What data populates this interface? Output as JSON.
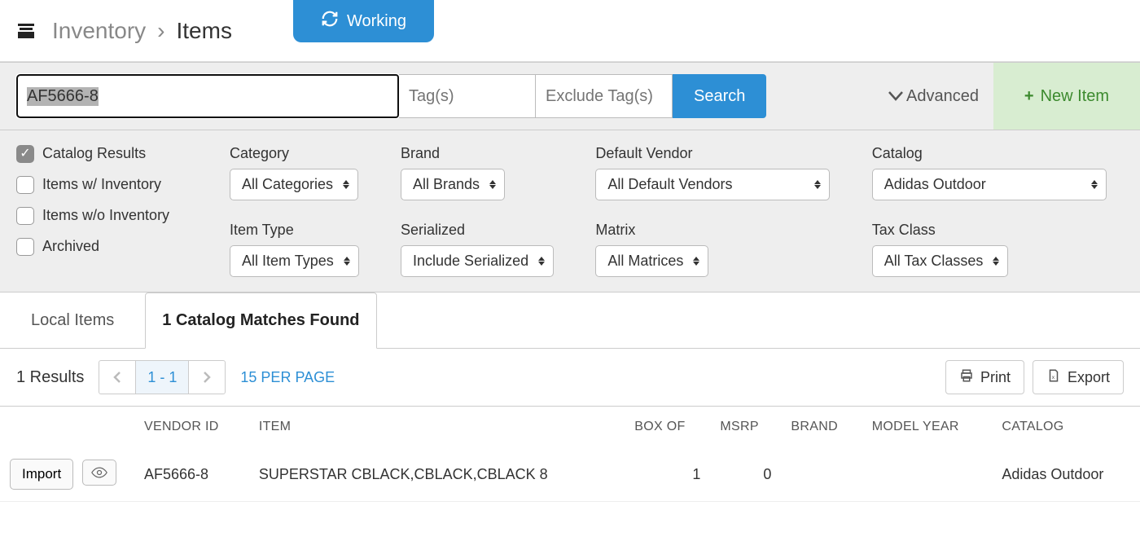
{
  "breadcrumb": {
    "root": "Inventory",
    "current": "Items"
  },
  "status_chip": "Working",
  "search": {
    "value": "AF5666-8",
    "tags_placeholder": "Tag(s)",
    "exclude_tags_placeholder": "Exclude Tag(s)",
    "search_button": "Search",
    "advanced_label": "Advanced",
    "new_item_label": "New Item"
  },
  "filter_checkboxes": {
    "catalog_results": {
      "label": "Catalog Results",
      "checked": true
    },
    "items_with_inventory": {
      "label": "Items w/ Inventory",
      "checked": false
    },
    "items_without_inventory": {
      "label": "Items w/o Inventory",
      "checked": false
    },
    "archived": {
      "label": "Archived",
      "checked": false
    }
  },
  "filters": {
    "category": {
      "label": "Category",
      "value": "All Categories"
    },
    "brand": {
      "label": "Brand",
      "value": "All Brands"
    },
    "vendor": {
      "label": "Default Vendor",
      "value": "All Default Vendors"
    },
    "catalog": {
      "label": "Catalog",
      "value": "Adidas Outdoor"
    },
    "item_type": {
      "label": "Item Type",
      "value": "All Item Types"
    },
    "serialized": {
      "label": "Serialized",
      "value": "Include Serialized"
    },
    "matrix": {
      "label": "Matrix",
      "value": "All Matrices"
    },
    "tax_class": {
      "label": "Tax Class",
      "value": "All Tax Classes"
    }
  },
  "tabs": {
    "local": "Local Items",
    "catalog_matches": "1 Catalog Matches Found"
  },
  "listbar": {
    "results": "1 Results",
    "page_range": "1 - 1",
    "per_page": "15 PER PAGE",
    "print": "Print",
    "export": "Export"
  },
  "columns": {
    "vendor_id": "VENDOR ID",
    "item": "ITEM",
    "box_of": "BOX OF",
    "msrp": "MSRP",
    "brand": "BRAND",
    "model_year": "MODEL YEAR",
    "catalog": "CATALOG"
  },
  "row_actions": {
    "import": "Import"
  },
  "rows": [
    {
      "vendor_id": "AF5666-8",
      "item": "SUPERSTAR CBLACK,CBLACK,CBLACK 8",
      "box_of": "1",
      "msrp": "0",
      "brand": "",
      "model_year": "",
      "catalog": "Adidas Outdoor"
    }
  ],
  "colors": {
    "accent_blue": "#2d8fd5",
    "accent_green_bg": "#d8edd1",
    "accent_green_fg": "#3c8a2e"
  }
}
